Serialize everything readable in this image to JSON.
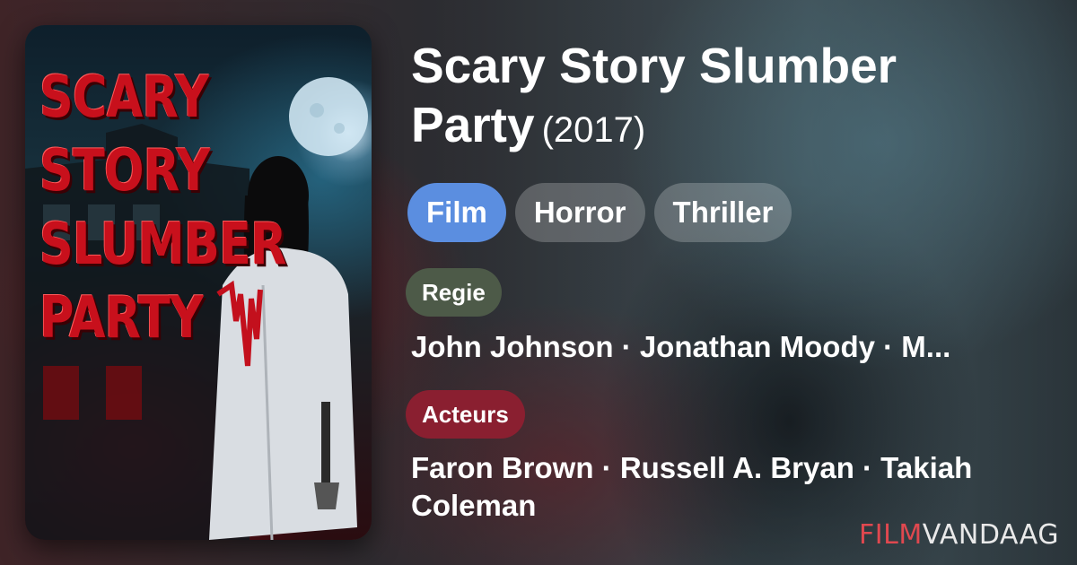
{
  "poster": {
    "title_art": "SCARY\nSTORY\nSLUMBER\nPARTY"
  },
  "movie": {
    "title": "Scary Story Slumber Party",
    "year": "(2017)"
  },
  "tags": [
    {
      "label": "Film"
    },
    {
      "label": "Horror"
    },
    {
      "label": "Thriller"
    }
  ],
  "regie": {
    "label": "Regie",
    "people": "John Johnson · Jonathan Moody · M..."
  },
  "acteurs": {
    "label": "Acteurs",
    "people": "Faron Brown · Russell A. Bryan · Takiah Coleman"
  },
  "brand": {
    "part1": "FILM",
    "part2": "VANDAAG"
  },
  "colors": {
    "tag_primary": "#5b8ee0",
    "regie_badge": "#4d5a48",
    "acteurs_badge": "#8a1f30",
    "brand_red": "#e0484f"
  }
}
